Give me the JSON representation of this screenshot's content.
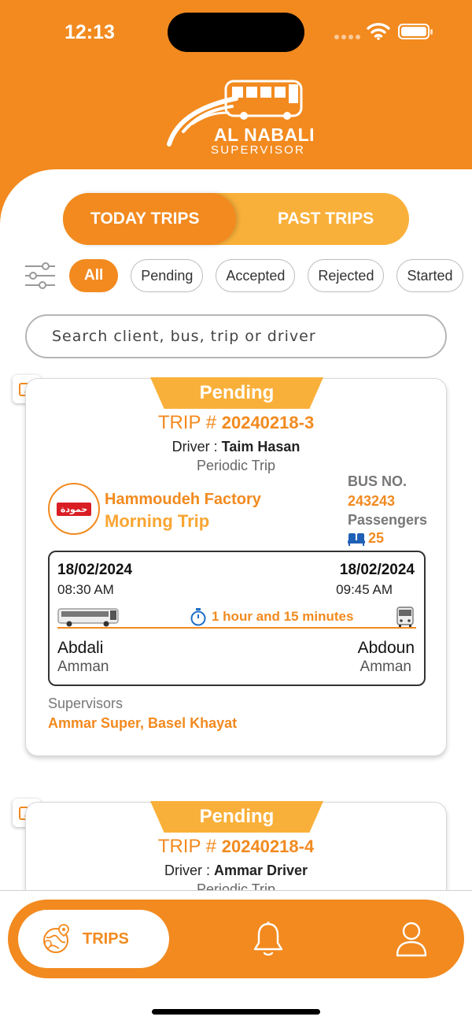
{
  "status_bar": {
    "time": "12:13"
  },
  "brand": {
    "title": "AL NABALI",
    "subtitle": "SUPERVISOR"
  },
  "tabs": {
    "today": "TODAY TRIPS",
    "past": "PAST TRIPS",
    "active": "today"
  },
  "filters": [
    "All",
    "Pending",
    "Accepted",
    "Rejected",
    "Started"
  ],
  "active_filter": "All",
  "search": {
    "placeholder": "Search client, bus, trip or driver"
  },
  "trips": [
    {
      "status": "Pending",
      "trip_prefix": "TRIP #",
      "trip_no": "20240218-3",
      "driver_label": "Driver :",
      "driver": "Taim Hasan",
      "type": "Periodic Trip",
      "client_logo_text": "حمودة",
      "client": "Hammoudeh Factory",
      "trip_name": "Morning Trip",
      "bus_label": "BUS NO.",
      "bus_no": "243243",
      "passengers_label": "Passengers",
      "passengers": "25",
      "start_date": "18/02/2024",
      "start_time": "08:30 AM",
      "end_date": "18/02/2024",
      "end_time": "09:45 AM",
      "duration": "1 hour and 15 minutes",
      "from_city": "Abdali",
      "from_region": "Amman",
      "to_city": "Abdoun",
      "to_region": "Amman",
      "supervisors_label": "Supervisors",
      "supervisors": "Ammar Super, Basel Khayat"
    },
    {
      "status": "Pending",
      "trip_prefix": "TRIP #",
      "trip_no": "20240218-4",
      "driver_label": "Driver :",
      "driver": "Ammar Driver",
      "type": "Periodic Trip"
    }
  ],
  "nav": {
    "trips": "TRIPS"
  },
  "colors": {
    "primary": "#f28a1f",
    "secondary": "#f9b03a"
  }
}
